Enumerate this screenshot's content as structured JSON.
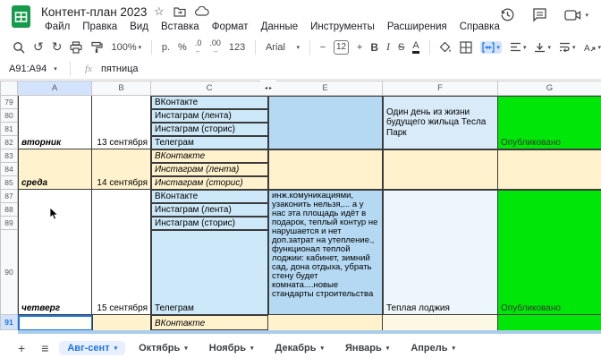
{
  "header": {
    "title": "Контент-план 2023",
    "menus": [
      "Файл",
      "Правка",
      "Вид",
      "Вставка",
      "Формат",
      "Данные",
      "Инструменты",
      "Расширения",
      "Справка"
    ]
  },
  "toolbar": {
    "zoom": "100%",
    "currency": "р.",
    "percent": "%",
    "dec_decrease": ".0",
    "dec_increase": ".00",
    "number_format": "123",
    "font_name": "Arial",
    "font_size": "12",
    "bold": "B",
    "italic": "I",
    "strikethrough": "S",
    "text_color": "A"
  },
  "formula_bar": {
    "name_box": "A91:A94",
    "fx": "fx",
    "value": "пятница"
  },
  "grid": {
    "columns": [
      "A",
      "B",
      "C",
      "E",
      "F",
      "G"
    ],
    "rows": [
      "79",
      "80",
      "81",
      "82",
      "83",
      "84",
      "85",
      "87",
      "88",
      "89",
      "90",
      "91"
    ],
    "tuesday": {
      "day": "вторник",
      "date": "13 сентября",
      "ch1": "ВКонтакте",
      "ch2": "Инстаграм (лента)",
      "ch3": "Инстаграм (сторис)",
      "ch4": "Телеграм",
      "idea": "Один день из жизни будущего жильца Тесла Парк",
      "status": "Опубликовано"
    },
    "wednesday": {
      "day": "среда",
      "date": "14 сентября",
      "ch1": "ВКонтакте",
      "ch2": "Инстаграм (лента)",
      "ch3": "Инстаграм (сторис)"
    },
    "thursday": {
      "day": "четверг",
      "date": "15 сентября",
      "ch1": "ВКонтакте",
      "ch2": "Инстаграм (лента)",
      "ch3": "Инстаграм (сторис)",
      "ch4": "Телеграм",
      "content": "инж.комуникациями, узаконить нельзя,... а у нас эта площадь идёт в подарок, теплый контур не нарушается и нет доп.затрат на утепление., функционал теплой лоджии: кабинет, зимний сад, дона отдыха, убрать стену будет комната....новые стандарты строительства",
      "idea": "Теплая лоджия",
      "status": "Опубликовано"
    },
    "friday": {
      "ch1": "ВКонтакте"
    }
  },
  "sheet_tabs": {
    "items": [
      {
        "label": "Авг-сент"
      },
      {
        "label": "Октябрь"
      },
      {
        "label": "Ноябрь"
      },
      {
        "label": "Декабрь"
      },
      {
        "label": "Январь"
      },
      {
        "label": "Апрель"
      }
    ]
  },
  "colors": {
    "accent_blue": "#1a73e8",
    "published_green": "#00e608",
    "note_yellow": "#fff2cc",
    "channel_cell_blue": "#cde8f8",
    "content_block_blue": "#b5d9f3",
    "idea_block_blue": "#d9ebf9",
    "pale_blue": "#edf6fc",
    "sheets_logo_green": "#169b4a"
  }
}
